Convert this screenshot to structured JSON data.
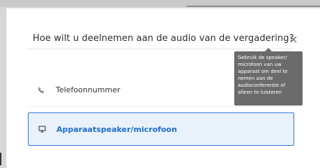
{
  "dialog": {
    "title": "Hoe wilt u deelnemen aan de audio van de vergadering?",
    "close_icon": "close-icon",
    "close_glyph": "×"
  },
  "options": [
    {
      "label": "Telefoonnummer",
      "icon": "phone-icon",
      "selected": false
    },
    {
      "label": "Apparaatspeaker/microfoon",
      "icon": "monitor-icon",
      "selected": true
    }
  ],
  "tooltip": {
    "text": "Gebruik de speaker/ microfoon van uw apparaat om deel te nemen aan de audioconferentie of alleen te luisteren"
  },
  "colors": {
    "accent": "#2f78d6",
    "selected_bg": "#e9f1fb",
    "tooltip_bg": "#6b6b6b"
  }
}
